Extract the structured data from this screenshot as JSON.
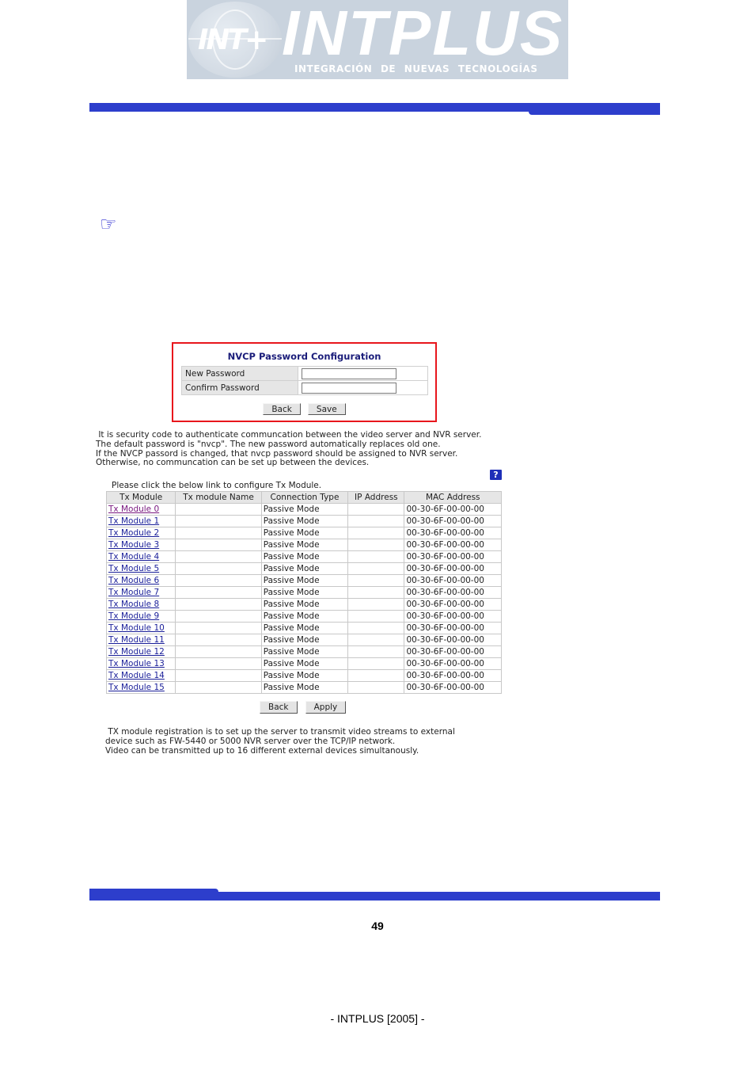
{
  "header": {
    "logo_mark": "INT+",
    "logo_word": "INTPLUS",
    "logo_tagline": "INTEGRACIÓN DE NUEVAS TECNOLOGÍAS",
    "brand_color": "#2d3ecc"
  },
  "pointer_icon": "☞",
  "password_panel": {
    "title": "NVCP Password Configuration",
    "fields": [
      {
        "label": "New Password",
        "value": ""
      },
      {
        "label": "Confirm Password",
        "value": ""
      }
    ],
    "back_label": "Back",
    "save_label": "Save",
    "highlight_color": "#e8161c"
  },
  "password_note": " It is security code to authenticate communcation between the video server and NVR server.\nThe default password is \"nvcp\". The new password automatically replaces old one.\nIf the NVCP passord is changed, that nvcp password should be assigned to NVR server.\nOtherwise, no communcation can be set up between the devices.",
  "help_icon": "?",
  "tx": {
    "caption": "Please click the below link to configure Tx Module.",
    "columns": [
      "Tx Module",
      "Tx module Name",
      "Connection Type",
      "IP Address",
      "MAC Address"
    ],
    "rows": [
      {
        "module": "Tx Module 0",
        "name": "",
        "type": "Passive Mode",
        "ip": "",
        "mac": "00-30-6F-00-00-00"
      },
      {
        "module": "Tx Module 1",
        "name": "",
        "type": "Passive Mode",
        "ip": "",
        "mac": "00-30-6F-00-00-00"
      },
      {
        "module": "Tx Module 2",
        "name": "",
        "type": "Passive Mode",
        "ip": "",
        "mac": "00-30-6F-00-00-00"
      },
      {
        "module": "Tx Module 3",
        "name": "",
        "type": "Passive Mode",
        "ip": "",
        "mac": "00-30-6F-00-00-00"
      },
      {
        "module": "Tx Module 4",
        "name": "",
        "type": "Passive Mode",
        "ip": "",
        "mac": "00-30-6F-00-00-00"
      },
      {
        "module": "Tx Module 5",
        "name": "",
        "type": "Passive Mode",
        "ip": "",
        "mac": "00-30-6F-00-00-00"
      },
      {
        "module": "Tx Module 6",
        "name": "",
        "type": "Passive Mode",
        "ip": "",
        "mac": "00-30-6F-00-00-00"
      },
      {
        "module": "Tx Module 7",
        "name": "",
        "type": "Passive Mode",
        "ip": "",
        "mac": "00-30-6F-00-00-00"
      },
      {
        "module": "Tx Module 8",
        "name": "",
        "type": "Passive Mode",
        "ip": "",
        "mac": "00-30-6F-00-00-00"
      },
      {
        "module": "Tx Module 9",
        "name": "",
        "type": "Passive Mode",
        "ip": "",
        "mac": "00-30-6F-00-00-00"
      },
      {
        "module": "Tx Module 10",
        "name": "",
        "type": "Passive Mode",
        "ip": "",
        "mac": "00-30-6F-00-00-00"
      },
      {
        "module": "Tx Module 11",
        "name": "",
        "type": "Passive Mode",
        "ip": "",
        "mac": "00-30-6F-00-00-00"
      },
      {
        "module": "Tx Module 12",
        "name": "",
        "type": "Passive Mode",
        "ip": "",
        "mac": "00-30-6F-00-00-00"
      },
      {
        "module": "Tx Module 13",
        "name": "",
        "type": "Passive Mode",
        "ip": "",
        "mac": "00-30-6F-00-00-00"
      },
      {
        "module": "Tx Module 14",
        "name": "",
        "type": "Passive Mode",
        "ip": "",
        "mac": "00-30-6F-00-00-00"
      },
      {
        "module": "Tx Module 15",
        "name": "",
        "type": "Passive Mode",
        "ip": "",
        "mac": "00-30-6F-00-00-00"
      }
    ],
    "back_label": "Back",
    "apply_label": "Apply"
  },
  "tx_note": " TX module registration is to set up the server to transmit video streams to external\ndevice such as FW-5440 or 5000 NVR server over the TCP/IP network.\nVideo can be transmitted up to 16 different external devices simultanously.",
  "page_number": "49",
  "footer": "- INTPLUS [2005] -"
}
